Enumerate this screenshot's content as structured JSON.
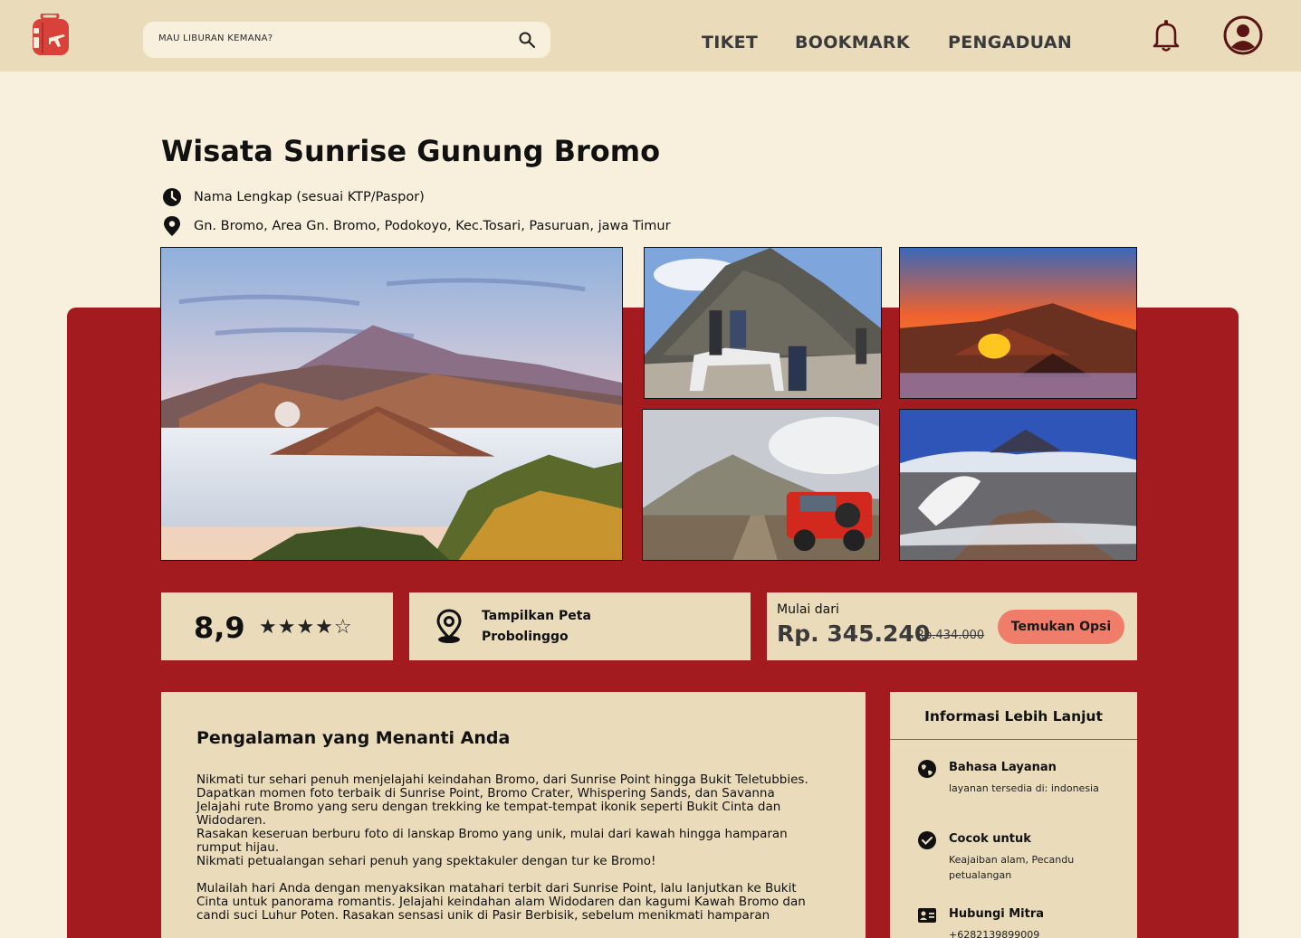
{
  "header": {
    "search_placeholder": "MAU LIBURAN KEMANA?",
    "nav": [
      "TIKET",
      "BOOKMARK",
      "PENGADUAN"
    ],
    "brand_color": "#d9423a"
  },
  "page": {
    "title": "Wisata Sunrise Gunung Bromo",
    "subtitle_line": "Nama Lengkap (sesuai KTP/Paspor)",
    "address": "Gn. Bromo, Area Gn. Bromo, Podokoyo, Kec.Tosari, Pasuruan, jawa Timur"
  },
  "gallery": {
    "photos": [
      "bromo-main-sunrise",
      "bromo-horse-ride",
      "bromo-sunset-crater",
      "bromo-jeep-savanna",
      "bromo-crater-smoke"
    ]
  },
  "rating": {
    "score": "8,9",
    "stars_filled": 4,
    "stars_total": 5,
    "stars_text": "★★★★☆"
  },
  "map": {
    "line1": "Tampilkan Peta",
    "line2": "Probolinggo"
  },
  "price": {
    "label": "Mulai dari",
    "current": "Rp. 345.240",
    "original": "Rp.434.000",
    "button": "Temukan Opsi"
  },
  "description": {
    "title": "Pengalaman yang Menanti Anda",
    "paragraphs": [
      "Nikmati tur sehari penuh menjelajahi keindahan Bromo, dari Sunrise Point hingga Bukit Teletubbies.",
      "Dapatkan momen foto terbaik di Sunrise Point, Bromo Crater, Whispering Sands, dan Savanna",
      "Jelajahi rute Bromo yang seru dengan trekking ke tempat-tempat ikonik seperti Bukit Cinta dan Widodaren.",
      "Rasakan keseruan berburu foto di lanskap Bromo yang unik, mulai dari kawah hingga hamparan rumput hijau.",
      "Nikmati petualangan sehari penuh yang spektakuler dengan tur ke Bromo!",
      "Mulailah hari Anda dengan menyaksikan matahari terbit dari Sunrise Point, lalu lanjutkan ke Bukit Cinta untuk panorama romantis. Jelajahi keindahan alam Widodaren dan kagumi Kawah Bromo dan candi suci Luhur Poten. Rasakan sensasi unik di Pasir Berbisik, sebelum menikmati hamparan"
    ]
  },
  "side_info": {
    "title": "Informasi Lebih Lanjut",
    "language_head": "Bahasa Layanan",
    "language_sub": "layanan tersedia di: indonesia",
    "suitable_head": "Cocok untuk",
    "suitable_sub": "Keajaiban alam, Pecandu petualangan",
    "contact_head": "Hubungi Mitra",
    "contact_sub": "+6282139899009"
  }
}
